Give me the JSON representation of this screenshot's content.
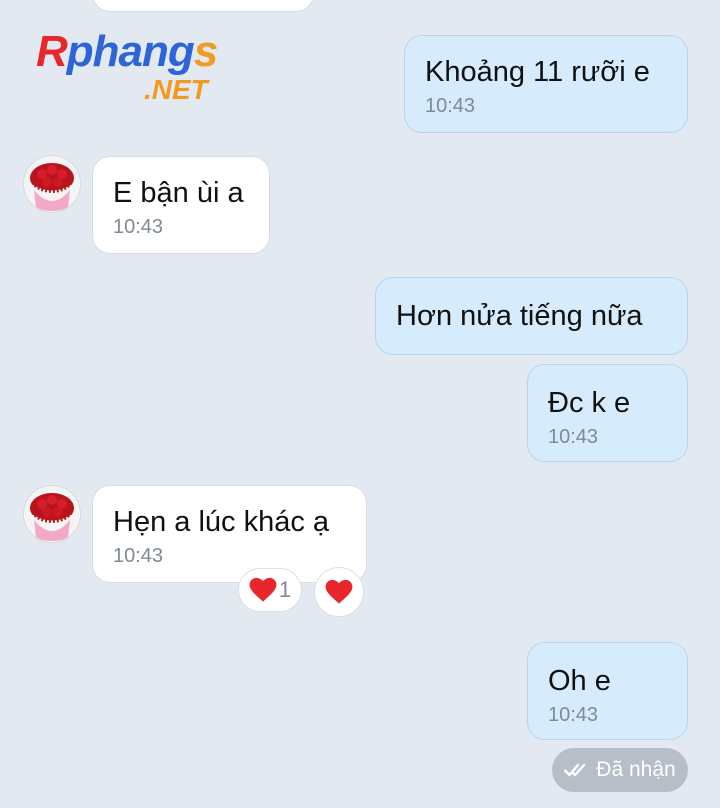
{
  "logo": {
    "main_r": "R",
    "main_rest": "phang",
    "main_s": "s",
    "suffix": ".NET"
  },
  "messages": [
    {
      "direction": "out",
      "text": "Khoảng 11 rưỡi e",
      "time": "10:43"
    },
    {
      "direction": "in",
      "text": "E bận ùi a",
      "time": "10:43"
    },
    {
      "direction": "out",
      "text": "Hơn nửa tiếng nữa",
      "time": ""
    },
    {
      "direction": "out",
      "text": "Đc k e",
      "time": "10:43"
    },
    {
      "direction": "in",
      "text": "Hẹn a lúc khác ạ",
      "time": "10:43",
      "reactions": {
        "summary_icon": "heart-icon",
        "summary_count": "1",
        "quick_icon": "heart-icon"
      }
    },
    {
      "direction": "out",
      "text": "Oh e",
      "time": "10:43"
    }
  ],
  "status": {
    "icon": "double-check-icon",
    "label": "Đã nhận"
  },
  "colors": {
    "background": "#e2e9f1",
    "incoming_bubble": "#ffffff",
    "outgoing_bubble": "#d6ecfd",
    "heart": "#e8262b",
    "status_pill": "#b7bec7"
  }
}
